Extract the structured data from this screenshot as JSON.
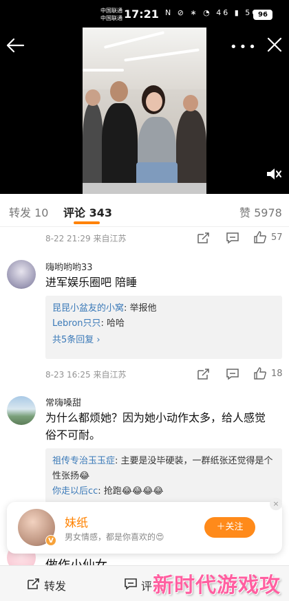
{
  "status_bar": {
    "carrier_1": "中国联通",
    "carrier_2": "中国联通",
    "time": "17:21",
    "icons_text": "N ⊘ ∗ ◔ 46 ▮ 5G ▮",
    "battery": "96"
  },
  "video": {
    "mute_icon": "speaker-mute-icon"
  },
  "tabs": [
    {
      "label": "转发 10"
    },
    {
      "label": "评论 343"
    },
    {
      "label": "赞 5978"
    }
  ],
  "accent_color": "#ff8200",
  "comment_prev": {
    "meta": "8-22 21:29 来自江苏",
    "likes": "57"
  },
  "comments": [
    {
      "username": "嗨哟哟哟33",
      "text": "进军娱乐圈吧 陪睡",
      "replies": [
        {
          "name": "昆昆小盆友的小窝",
          "text": ": 举报他"
        },
        {
          "name": "Lebron只只",
          "text": ": 哈哈"
        }
      ],
      "more_replies": "共5条回复 ›",
      "meta": "8-23 16:25 来自江苏",
      "likes": "18"
    },
    {
      "username": "常嗨嗓甜",
      "text": "为什么都烦她？因为她小动作太多，给人感觉俗不可耐。",
      "replies": [
        {
          "name": "祖传专治玉玉症",
          "text": ": 主要是没毕硬装，一群纸张还觉得是个性张扬😂"
        },
        {
          "name": "你走以后cc",
          "text": ": 抢跑😂😂😂😂"
        }
      ]
    }
  ],
  "follow_card": {
    "name": "妹纸",
    "description": "男女情感，都是你喜欢的😍",
    "button": "＋关注",
    "close": "×",
    "badge": "V"
  },
  "partial_comment_text": "做作小仙女",
  "bottom_bar": {
    "repost": "转发",
    "comment": "评",
    "watermark": "新时代游戏攻略"
  }
}
